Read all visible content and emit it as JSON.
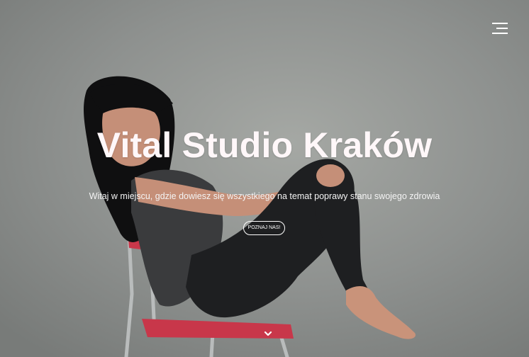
{
  "hero": {
    "title": "Vital Studio Kraków",
    "subtitle": "Witaj w miejscu, gdzie dowiesz się wszystkiego na temat poprawy stanu swojego zdrowia",
    "cta_label": "POZNAJ NAS!",
    "background_image": "woman-on-chair-photo"
  },
  "nav": {
    "menu_icon": "hamburger-icon"
  },
  "scroll": {
    "icon": "chevron-down-icon"
  },
  "colors": {
    "background": "#8f9290",
    "title": "#fff7f9",
    "chair": "#c8374a",
    "text": "#ffffff"
  }
}
